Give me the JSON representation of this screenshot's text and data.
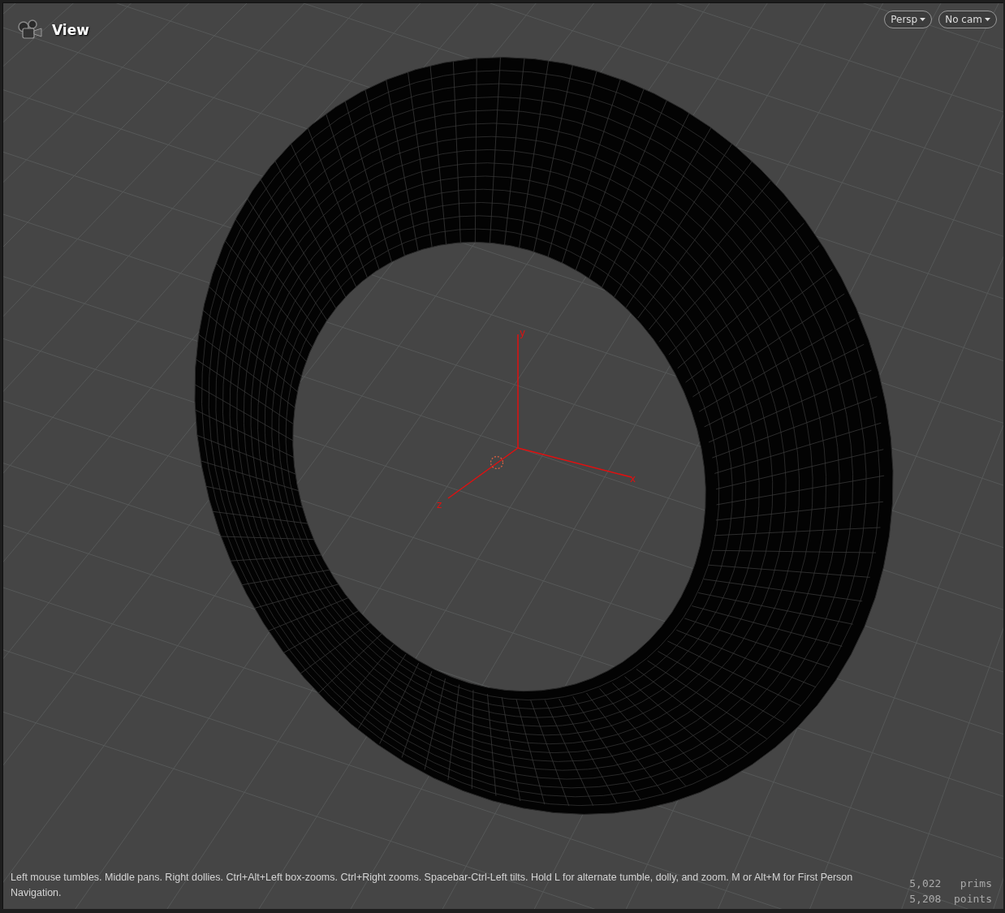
{
  "viewport": {
    "title": "View",
    "view_menus": [
      {
        "label": "Persp"
      },
      {
        "label": "No cam"
      }
    ],
    "axis_labels": [
      {
        "kind": "x",
        "label": "x"
      },
      {
        "kind": "y",
        "label": "y"
      },
      {
        "kind": "z",
        "label": "z"
      }
    ],
    "help_text": "Left mouse tumbles. Middle pans. Right dollies. Ctrl+Alt+Left box-zooms. Ctrl+Right zooms. Spacebar-Ctrl-Left tilts. Hold L for alternate tumble, dolly, and zoom. M or Alt+M for First Person Navigation.",
    "stats": [
      {
        "value": "5,022",
        "label": "prims"
      },
      {
        "value": "5,208",
        "label": "points"
      }
    ]
  }
}
